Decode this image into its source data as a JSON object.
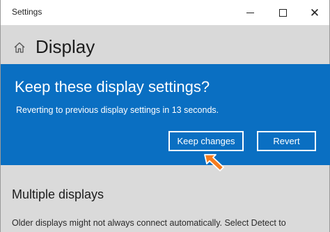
{
  "window": {
    "title": "Settings",
    "minimize_icon": "minimize-icon",
    "maximize_icon": "maximize-icon",
    "close_icon": "close-icon"
  },
  "header": {
    "home_icon": "home-icon",
    "title": "Display"
  },
  "dialog": {
    "title": "Keep these display settings?",
    "message": "Reverting to previous display settings in 13 seconds.",
    "keep_label": "Keep changes",
    "revert_label": "Revert",
    "countdown_seconds": 13
  },
  "section": {
    "heading": "Multiple displays",
    "text": "Older displays might not always connect automatically. Select Detect to"
  },
  "colors": {
    "dialog_background": "#0a6fc2",
    "cursor_arrow": "#f57c1f",
    "window_background": "#dcdcdc"
  }
}
